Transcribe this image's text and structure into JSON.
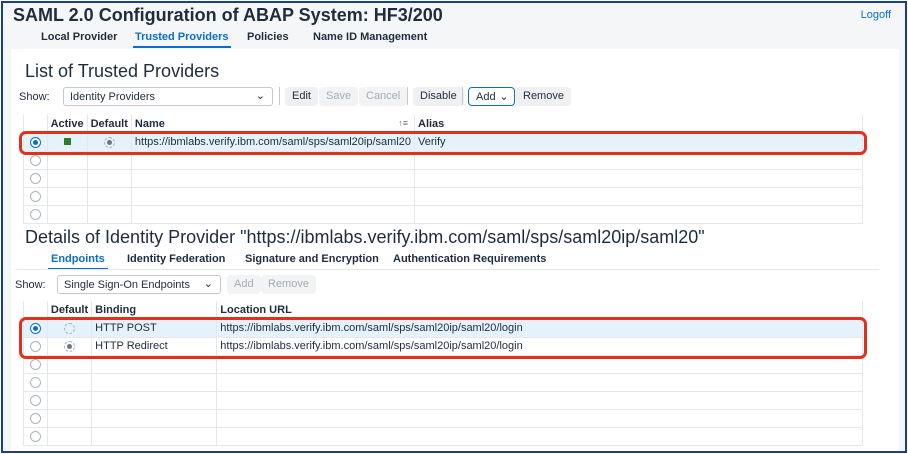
{
  "window": {
    "title": "SAML 2.0 Configuration of ABAP System: HF3/200",
    "logoff": "Logoff"
  },
  "main_tabs": [
    {
      "label": "Local Provider"
    },
    {
      "label": "Trusted Providers"
    },
    {
      "label": "Policies"
    },
    {
      "label": "Name ID Management"
    }
  ],
  "providers": {
    "heading": "List of Trusted Providers",
    "show_label": "Show:",
    "show_value": "Identity Providers",
    "buttons": {
      "edit": "Edit",
      "save": "Save",
      "cancel": "Cancel",
      "disable": "Disable",
      "add": "Add",
      "remove": "Remove"
    },
    "columns": {
      "active": "Active",
      "default": "Default",
      "name": "Name",
      "alias": "Alias"
    },
    "rows": [
      {
        "name": "https://ibmlabs.verify.ibm.com/saml/sps/saml20ip/saml20",
        "alias": "Verify"
      }
    ]
  },
  "details": {
    "heading": "Details of Identity Provider \"https://ibmlabs.verify.ibm.com/saml/sps/saml20ip/saml20\"",
    "tabs": [
      {
        "label": "Endpoints"
      },
      {
        "label": "Identity Federation"
      },
      {
        "label": "Signature and Encryption"
      },
      {
        "label": "Authentication Requirements"
      }
    ],
    "show_label": "Show:",
    "show_value": "Single Sign-On Endpoints",
    "buttons": {
      "add": "Add",
      "remove": "Remove"
    },
    "columns": {
      "default": "Default",
      "binding": "Binding",
      "location": "Location URL"
    },
    "rows": [
      {
        "binding": "HTTP POST",
        "location": "https://ibmlabs.verify.ibm.com/saml/sps/saml20ip/saml20/login"
      },
      {
        "binding": "HTTP Redirect",
        "location": "https://ibmlabs.verify.ibm.com/saml/sps/saml20ip/saml20/login"
      }
    ]
  },
  "colors": {
    "accent": "#0a6ed1",
    "highlight": "#e0301e",
    "frame": "#1b3f8f",
    "active_status": "#2b7d2b"
  }
}
